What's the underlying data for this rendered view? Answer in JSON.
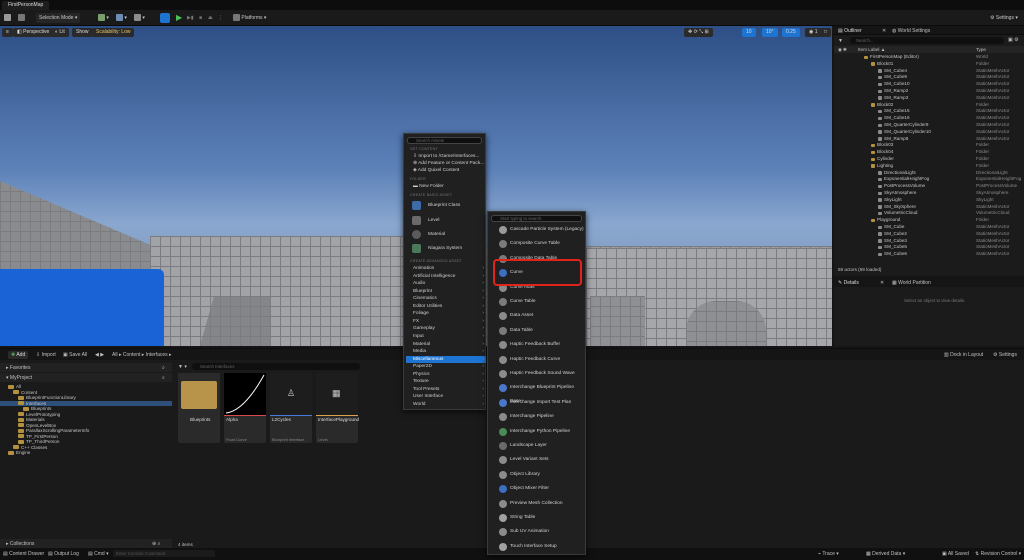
{
  "window": {
    "tab_title": "FirstPersonMap"
  },
  "toolbar": {
    "selection_mode": "Selection Mode",
    "platforms": "Platforms",
    "settings": "Settings"
  },
  "viewport": {
    "perspective": "Perspective",
    "lit": "Lit",
    "show": "Show",
    "scalability": "Scalability: Low",
    "grid_snap": "10",
    "rot_snap": "10°",
    "scale_snap": "0.25",
    "camera_speed": "1"
  },
  "outliner": {
    "tab_outliner": "Outliner",
    "tab_world_settings": "World Settings",
    "search_placeholder": "Search...",
    "col_label": "Item Label ▲",
    "col_type": "Type",
    "rows": [
      {
        "label": "FirstPersonMap (Editor)",
        "type": "World",
        "indent": 0
      },
      {
        "label": "Block01",
        "type": "Folder",
        "indent": 1
      },
      {
        "label": "SM_Cube4",
        "type": "StaticMeshActor",
        "indent": 2
      },
      {
        "label": "SM_Cube9",
        "type": "StaticMeshActor",
        "indent": 2
      },
      {
        "label": "SM_Cube10",
        "type": "StaticMeshActor",
        "indent": 2
      },
      {
        "label": "SM_Ramp2",
        "type": "StaticMeshActor",
        "indent": 2
      },
      {
        "label": "SM_Ramp3",
        "type": "StaticMeshActor",
        "indent": 2
      },
      {
        "label": "Block02",
        "type": "Folder",
        "indent": 1
      },
      {
        "label": "SM_Cube15",
        "type": "StaticMeshActor",
        "indent": 2
      },
      {
        "label": "SM_Cube16",
        "type": "StaticMeshActor",
        "indent": 2
      },
      {
        "label": "SM_QuarterCylinder9",
        "type": "StaticMeshActor",
        "indent": 2
      },
      {
        "label": "SM_QuarterCylinder10",
        "type": "StaticMeshActor",
        "indent": 2
      },
      {
        "label": "SM_Ramp8",
        "type": "StaticMeshActor",
        "indent": 2
      },
      {
        "label": "Block03",
        "type": "Folder",
        "indent": 1
      },
      {
        "label": "Block04",
        "type": "Folder",
        "indent": 1
      },
      {
        "label": "Cylinder",
        "type": "Folder",
        "indent": 1
      },
      {
        "label": "Lighting",
        "type": "Folder",
        "indent": 1
      },
      {
        "label": "DirectionalLight",
        "type": "DirectionalLight",
        "indent": 2
      },
      {
        "label": "ExponentialHeightFog",
        "type": "ExponentialHeightFog",
        "indent": 2
      },
      {
        "label": "PostProcessVolume",
        "type": "PostProcessVolume",
        "indent": 2
      },
      {
        "label": "SkyAtmosphere",
        "type": "SkyAtmosphere",
        "indent": 2
      },
      {
        "label": "SkyLight",
        "type": "SkyLight",
        "indent": 2
      },
      {
        "label": "SM_SkySphere",
        "type": "StaticMeshActor",
        "indent": 2
      },
      {
        "label": "VolumetricCloud",
        "type": "VolumetricCloud",
        "indent": 2
      },
      {
        "label": "Playground",
        "type": "Folder",
        "indent": 1
      },
      {
        "label": "SM_Cube",
        "type": "StaticMeshActor",
        "indent": 2
      },
      {
        "label": "SM_Cube2",
        "type": "StaticMeshActor",
        "indent": 2
      },
      {
        "label": "SM_Cube3",
        "type": "StaticMeshActor",
        "indent": 2
      },
      {
        "label": "SM_Cube5",
        "type": "StaticMeshActor",
        "indent": 2
      },
      {
        "label": "SM_Cube6",
        "type": "StaticMeshActor",
        "indent": 2
      }
    ],
    "actor_count": "59 actors (59 loaded)"
  },
  "details": {
    "tab_details": "Details",
    "tab_world_partition": "World Partition",
    "empty_msg": "Select an object to view details."
  },
  "content_browser": {
    "add": "Add",
    "import": "Import",
    "save_all": "Save All",
    "breadcrumb": [
      "All",
      "Content",
      "Interfaces"
    ],
    "dock_in_layout": "Dock in Layout",
    "settings": "Settings",
    "favorites": "Favorites",
    "project": "MyProject",
    "search_placeholder": "Search Interfaces",
    "tree": [
      {
        "label": "All",
        "indent": 0
      },
      {
        "label": "Content",
        "indent": 1
      },
      {
        "label": "BlueprintFunctionLibrary",
        "indent": 2
      },
      {
        "label": "Interfaces",
        "indent": 2,
        "selected": true
      },
      {
        "label": "Blueprints",
        "indent": 3
      },
      {
        "label": "LevelPrototyping",
        "indent": 2
      },
      {
        "label": "Materials",
        "indent": 2
      },
      {
        "label": "OpenLevelBox",
        "indent": 2
      },
      {
        "label": "ParallaxScrollingParameterInfo",
        "indent": 2
      },
      {
        "label": "TP_FirstPerson",
        "indent": 2
      },
      {
        "label": "TP_ThirdPerson",
        "indent": 2
      },
      {
        "label": "C++ Classes",
        "indent": 1
      },
      {
        "label": "Engine",
        "indent": 0
      }
    ],
    "assets": [
      {
        "name": "Blueprints",
        "type": ""
      },
      {
        "name": "Alpha",
        "type": "Float Curve"
      },
      {
        "name": "L2Cycles",
        "type": "Blueprint Interface"
      },
      {
        "name": "InterfacePlayground",
        "type": "Level"
      }
    ],
    "collections": "Collections",
    "item_count": "4 items"
  },
  "status": {
    "content_drawer": "Content Drawer",
    "output_log": "Output Log",
    "cmd": "Cmd",
    "cmd_placeholder": "Enter Console Command",
    "trace": "Trace",
    "derived_data": "Derived Data",
    "all_saved": "All Saved",
    "revision_control": "Revision Control"
  },
  "menu1": {
    "search_placeholder": "Search Assets",
    "sec_get_content": "GET CONTENT",
    "get_content": [
      "Import to /Game/Interfaces...",
      "Add Feature or Content Pack...",
      "Add Quixel Content"
    ],
    "sec_folder": "FOLDER",
    "new_folder": "New Folder",
    "sec_basic": "CREATE BASIC ASSET",
    "basic": [
      "Blueprint Class",
      "Level",
      "Material",
      "Niagara System"
    ],
    "sec_advanced": "CREATE ADVANCED ASSET",
    "advanced": [
      "Animation",
      "Artificial Intelligence",
      "Audio",
      "Blueprint",
      "Cinematics",
      "Editor Utilities",
      "Foliage",
      "FX",
      "Gameplay",
      "Input",
      "Material",
      "Media",
      "Miscellaneous",
      "Paper2D",
      "Physics",
      "Texture",
      "Tool Presets",
      "User Interface",
      "World"
    ]
  },
  "menu2": {
    "search_placeholder": "Start typing to search",
    "items": [
      "Cascade Particle System (Legacy)",
      "Composite Curve Table",
      "Composite Data Table",
      "Curve",
      "Curve Atlas",
      "Curve Table",
      "Data Asset",
      "Data Table",
      "Haptic Feedback Buffer",
      "Haptic Feedback Curve",
      "Haptic Feedback Sound Wave",
      "Interchange Blueprint Pipeline Base",
      "Interchange Import Test Plan",
      "Interchange Pipeline",
      "Interchange Python Pipeline",
      "Landscape Layer",
      "Level Variant Sets",
      "Object Library",
      "Object Mixer Filter",
      "Preview Mesh Collection",
      "String Table",
      "Sub UV Animation",
      "Touch Interface Setup"
    ]
  },
  "colors": {
    "accent": "#1d74d1",
    "highlight": "#e0241b",
    "folder": "#b3913f"
  }
}
